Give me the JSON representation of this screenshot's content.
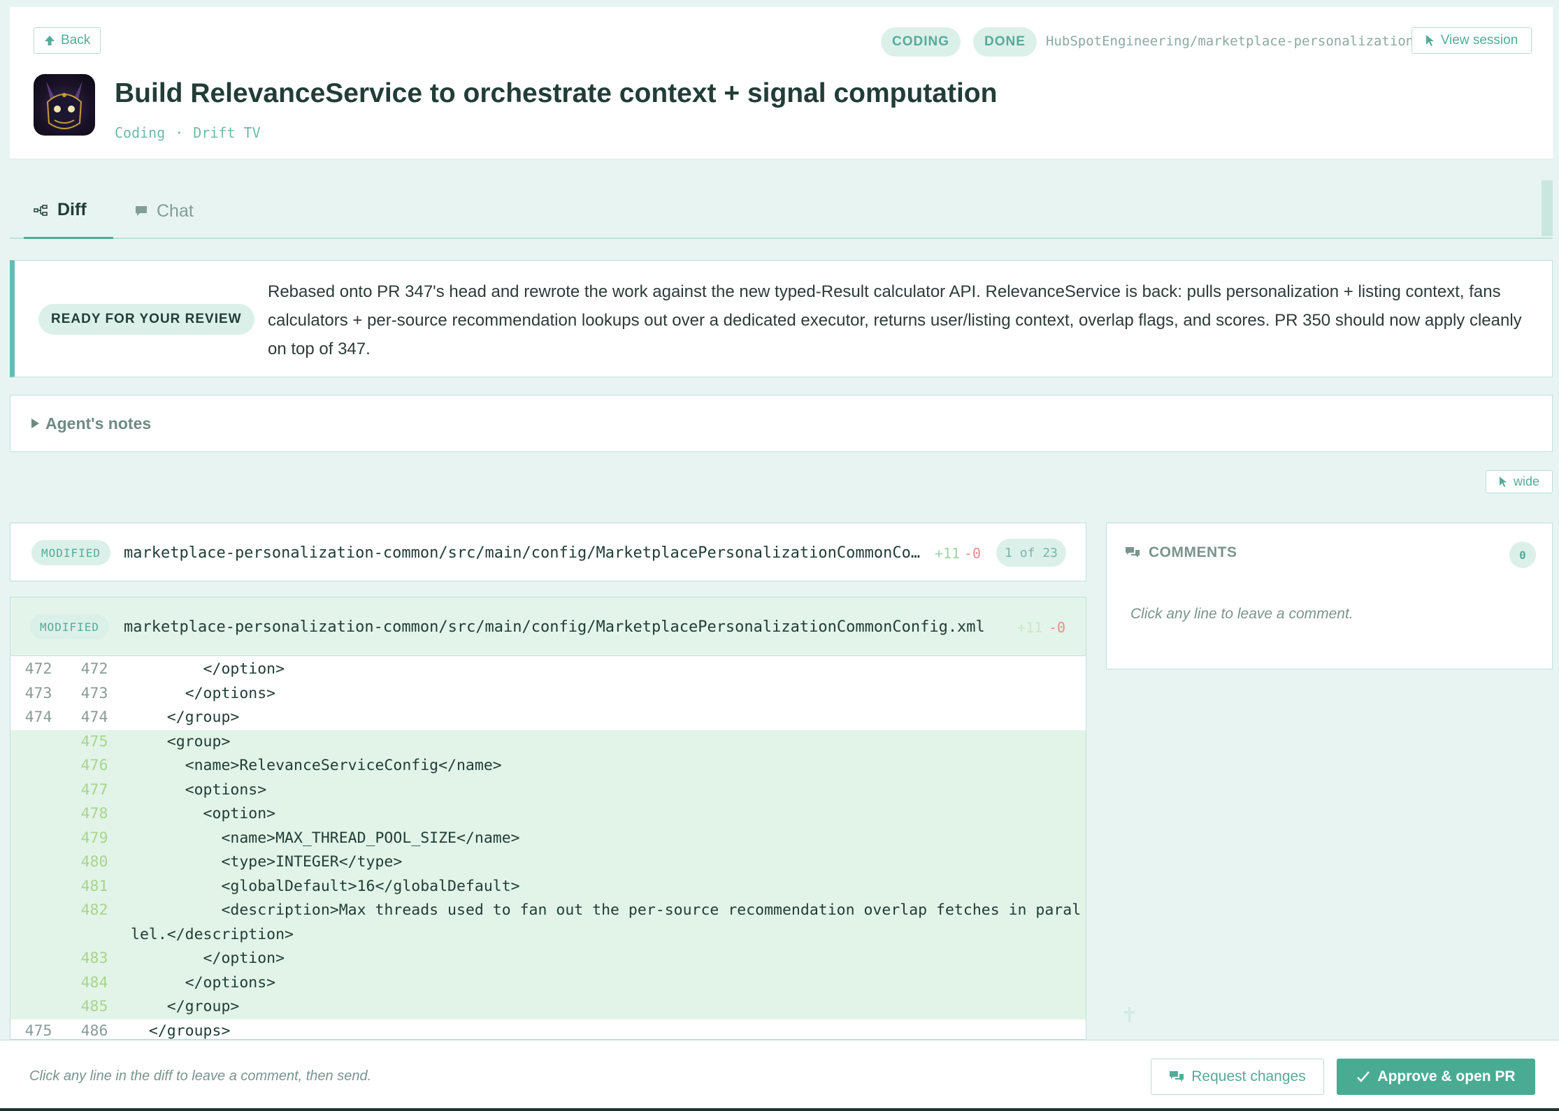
{
  "header": {
    "back_label": "Back",
    "pills": [
      "CODING",
      "DONE"
    ],
    "repo": "HubSpotEngineering/marketplace-personalization",
    "view_session_label": "View session",
    "title": "Build RelevanceService to orchestrate context + signal computation",
    "subtitle_type": "Coding",
    "subtitle_sep": "·",
    "subtitle_project": "Drift TV"
  },
  "tabs": [
    {
      "label": "Diff",
      "icon": "diff-icon",
      "active": true
    },
    {
      "label": "Chat",
      "icon": "chat-bubble-icon",
      "active": false
    }
  ],
  "review": {
    "badge": "READY FOR YOUR REVIEW",
    "text": "Rebased onto PR 347's head and rewrote the work against the new typed-Result calculator API. RelevanceService is back: pulls personalization + listing context, fans calculators + per-source recommendation lookups out over a dedicated executor, returns user/listing context, overlap flags, and scores. PR 350 should now apply cleanly on top of 347."
  },
  "agent_notes_label": "Agent's notes",
  "wide_label": "wide",
  "file_summary": {
    "status": "MODIFIED",
    "path": "marketplace-personalization-common/src/main/config/MarketplacePersonalizationCommonCon…",
    "additions": "+11",
    "deletions": "-0",
    "counter": "1 of 23"
  },
  "diff": {
    "status": "MODIFIED",
    "path": "marketplace-personalization-common/src/main/config/MarketplacePersonalizationCommonConfig.xml",
    "additions": "+11",
    "deletions": "-0",
    "lines": [
      {
        "old": "472",
        "new": "472",
        "type": "ctx",
        "code": "        </option>"
      },
      {
        "old": "473",
        "new": "473",
        "type": "ctx",
        "code": "      </options>"
      },
      {
        "old": "474",
        "new": "474",
        "type": "ctx",
        "code": "    </group>"
      },
      {
        "old": "",
        "new": "475",
        "type": "add",
        "code": "    <group>"
      },
      {
        "old": "",
        "new": "476",
        "type": "add",
        "code": "      <name>RelevanceServiceConfig</name>"
      },
      {
        "old": "",
        "new": "477",
        "type": "add",
        "code": "      <options>"
      },
      {
        "old": "",
        "new": "478",
        "type": "add",
        "code": "        <option>"
      },
      {
        "old": "",
        "new": "479",
        "type": "add",
        "code": "          <name>MAX_THREAD_POOL_SIZE</name>"
      },
      {
        "old": "",
        "new": "480",
        "type": "add",
        "code": "          <type>INTEGER</type>"
      },
      {
        "old": "",
        "new": "481",
        "type": "add",
        "code": "          <globalDefault>16</globalDefault>"
      },
      {
        "old": "",
        "new": "482",
        "type": "add",
        "code": "          <description>Max threads used to fan out the per-source recommendation overlap fetches in parallel.</description>"
      },
      {
        "old": "",
        "new": "483",
        "type": "add",
        "code": "        </option>"
      },
      {
        "old": "",
        "new": "484",
        "type": "add",
        "code": "      </options>"
      },
      {
        "old": "",
        "new": "485",
        "type": "add",
        "code": "    </group>"
      },
      {
        "old": "475",
        "new": "486",
        "type": "ctx",
        "code": "  </groups>"
      }
    ]
  },
  "comments": {
    "title": "COMMENTS",
    "count": "0",
    "empty_text": "Click any line to leave a comment."
  },
  "footer": {
    "hint": "Click any line in the diff to leave a comment, then send.",
    "request_changes_label": "Request changes",
    "approve_label": "Approve & open PR"
  },
  "colors": {
    "accent": "#4aab93",
    "pill_bg": "#dcf0ea",
    "added_bg": "#e2f4e8",
    "page_bg": "#e8f4f2"
  }
}
